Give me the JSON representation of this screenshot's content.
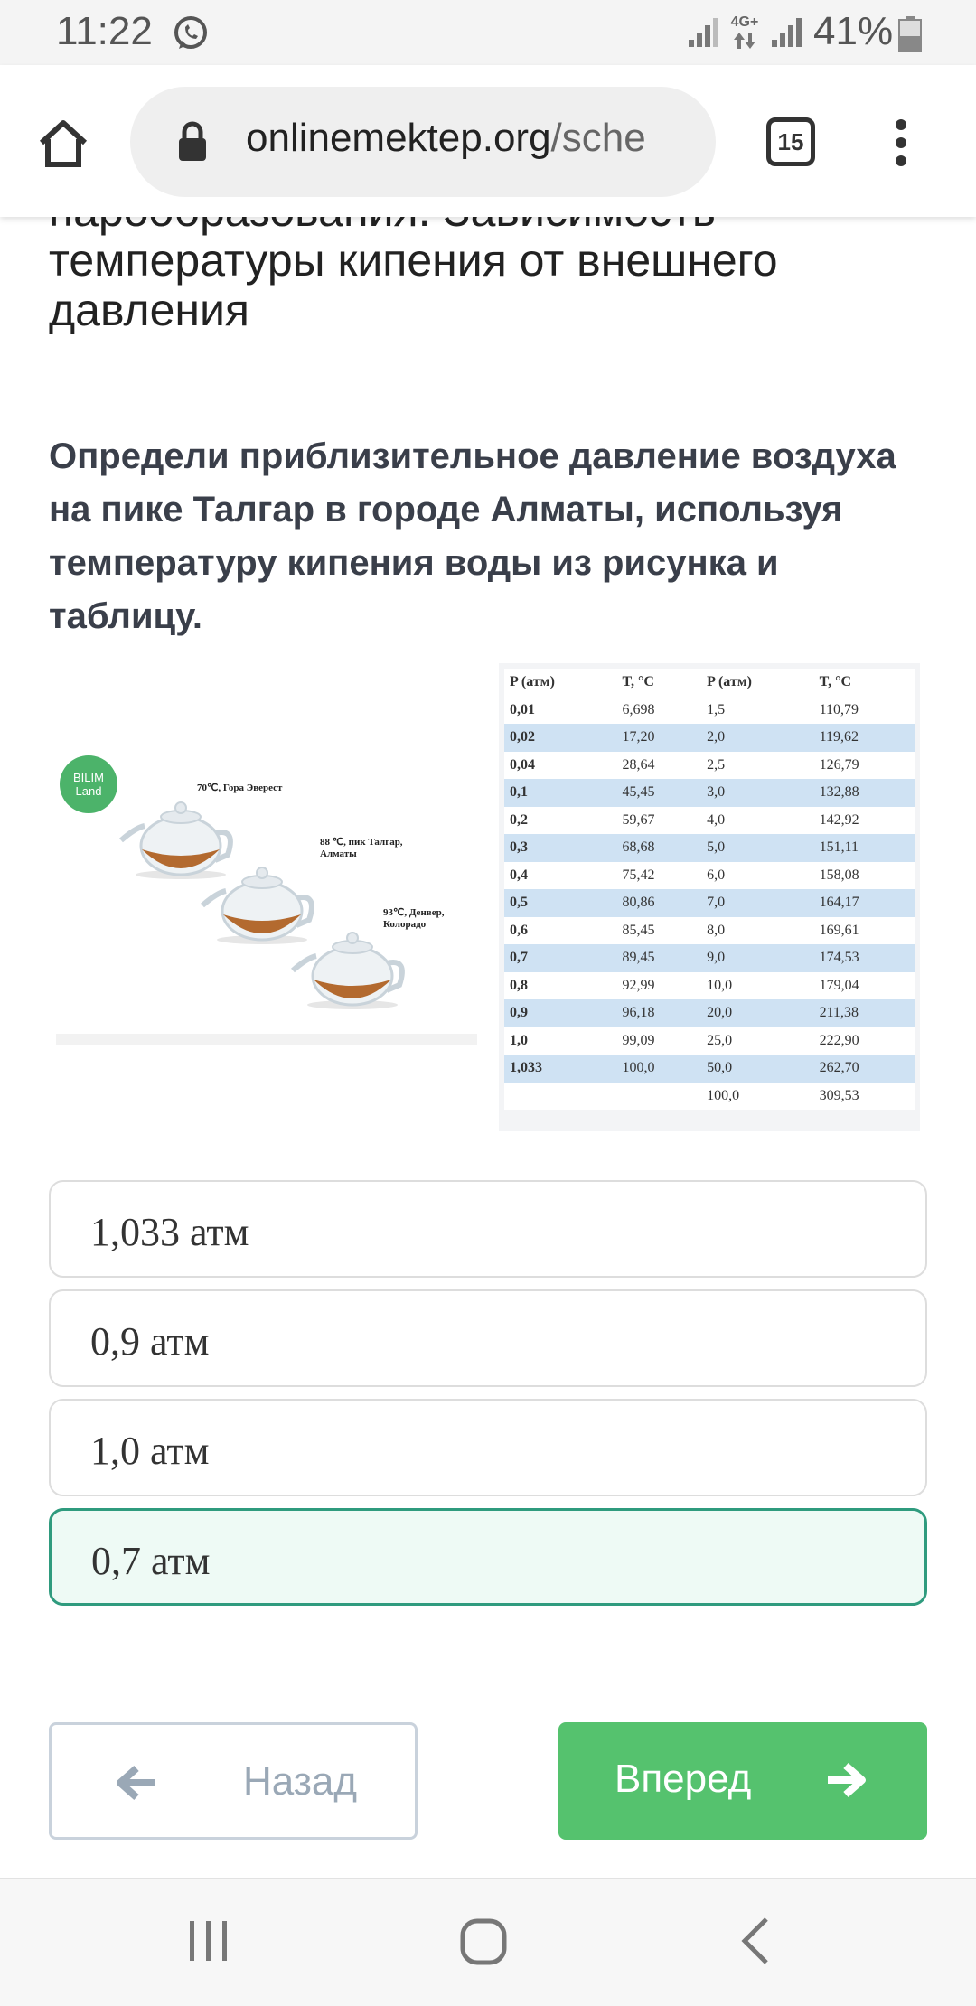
{
  "status_bar": {
    "time": "11:22",
    "network_type": "4G+",
    "battery": "41%"
  },
  "browser": {
    "url_host": "onlinemektep.org",
    "url_path": "/sche",
    "tab_count": "15"
  },
  "lesson": {
    "title_lines": [
      "парообразования. Зависимость",
      "температуры кипения от внешнего",
      "давления"
    ]
  },
  "question": {
    "text": "Определи приблизительное давление воздуха на пике Талгар в городе Алматы, используя температуру кипения воды из рисунка и таблицу."
  },
  "figure": {
    "logo_text": "BILIM Land",
    "kettles": [
      {
        "caption": "70℃, Гора Эверест"
      },
      {
        "caption": "88 ℃, пик Талгар, Алматы"
      },
      {
        "caption": "93℃, Денвер, Колорадо"
      }
    ]
  },
  "chart_data": {
    "type": "table",
    "columns": [
      "P (атм)",
      "T, °C",
      "P (атм)",
      "T, °C"
    ],
    "rows": [
      [
        "0,01",
        "6,698",
        "1,5",
        "110,79"
      ],
      [
        "0,02",
        "17,20",
        "2,0",
        "119,62"
      ],
      [
        "0,04",
        "28,64",
        "2,5",
        "126,79"
      ],
      [
        "0,1",
        "45,45",
        "3,0",
        "132,88"
      ],
      [
        "0,2",
        "59,67",
        "4,0",
        "142,92"
      ],
      [
        "0,3",
        "68,68",
        "5,0",
        "151,11"
      ],
      [
        "0,4",
        "75,42",
        "6,0",
        "158,08"
      ],
      [
        "0,5",
        "80,86",
        "7,0",
        "164,17"
      ],
      [
        "0,6",
        "85,45",
        "8,0",
        "169,61"
      ],
      [
        "0,7",
        "89,45",
        "9,0",
        "174,53"
      ],
      [
        "0,8",
        "92,99",
        "10,0",
        "179,04"
      ],
      [
        "0,9",
        "96,18",
        "20,0",
        "211,38"
      ],
      [
        "1,0",
        "99,09",
        "25,0",
        "222,90"
      ],
      [
        "1,033",
        "100,0",
        "50,0",
        "262,70"
      ],
      [
        "",
        "",
        "100,0",
        "309,53"
      ]
    ]
  },
  "options": [
    {
      "label": "1,033 атм",
      "selected": false
    },
    {
      "label": "0,9 атм",
      "selected": false
    },
    {
      "label": "1,0 атм",
      "selected": false
    },
    {
      "label": "0,7 атм",
      "selected": true
    }
  ],
  "navigation": {
    "back_label": "Назад",
    "next_label": "Вперед"
  },
  "colors": {
    "next_button": "#55c26e",
    "selected_option_border": "#2f9b7e",
    "table_stripe": "#cfe2f3"
  }
}
